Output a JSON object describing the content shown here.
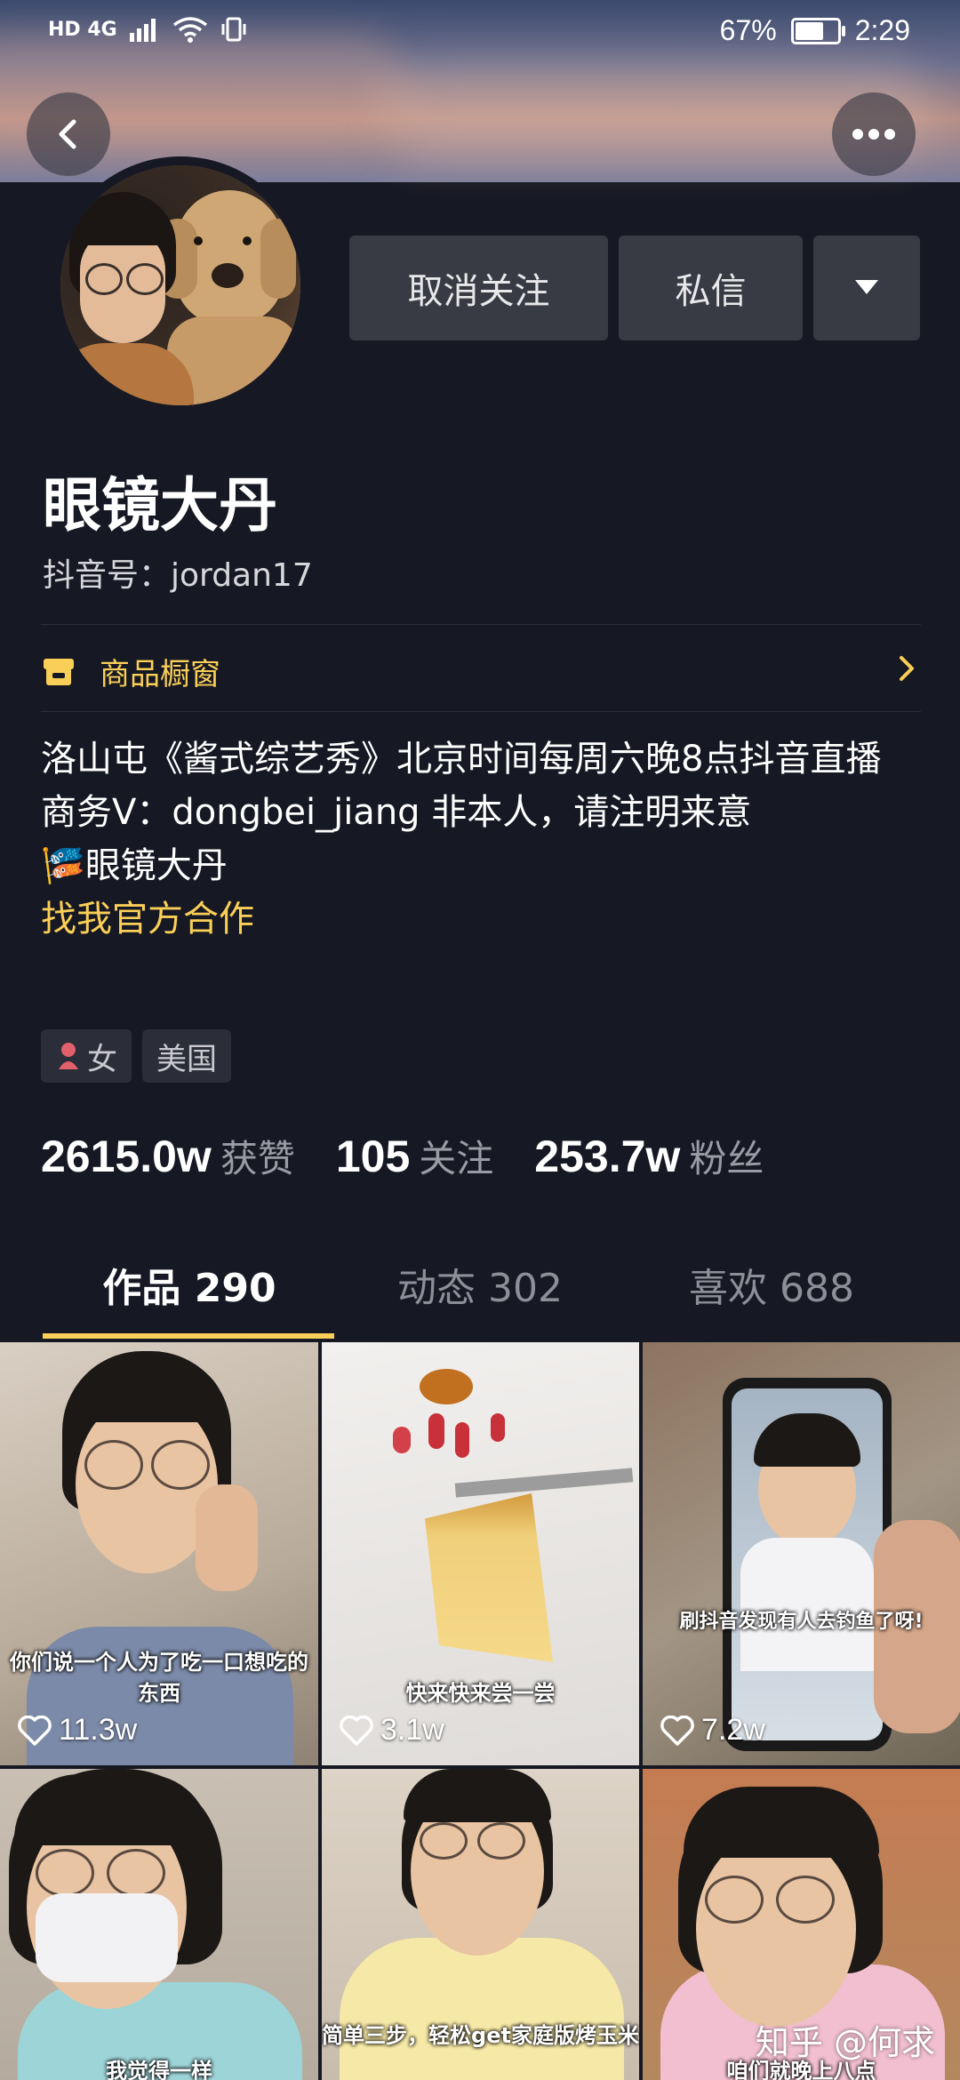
{
  "status_bar": {
    "network": "HD 4G",
    "battery": "67%",
    "battery_level": 0.67,
    "time": "2:29"
  },
  "header": {
    "back_icon": "chevron-left-icon",
    "more_icon": "more-dots-icon"
  },
  "profile": {
    "name": "眼镜大丹",
    "douyin_id": "抖音号：jordan17",
    "actions": {
      "unfollow": "取消关注",
      "message": "私信",
      "dropdown_icon": "triangle-down-icon"
    },
    "shop": {
      "label": "商品橱窗",
      "icon": "shop-icon"
    },
    "bio": {
      "line1": "洛山屯《酱式综艺秀》北京时间每周六晚8点抖音直播",
      "line2": "商务V：dongbei_jiang 非本人，请注明来意",
      "line3_emoji": "🎏",
      "line3": "眼镜大丹",
      "link": "找我官方合作"
    },
    "tags": {
      "gender_icon": "female-icon",
      "gender": "女",
      "location": "美国"
    },
    "stats": {
      "likes_value": "2615.0w",
      "likes_label": "获赞",
      "following_value": "105",
      "following_label": "关注",
      "followers_value": "253.7w",
      "followers_label": "粉丝"
    }
  },
  "tabs": [
    {
      "label": "作品 290",
      "active": true
    },
    {
      "label": "动态 302",
      "active": false
    },
    {
      "label": "喜欢 688",
      "active": false
    }
  ],
  "videos": [
    {
      "caption": "你们说一个人为了吃一口想吃的东西",
      "likes": "11.3w"
    },
    {
      "caption": "快来快来尝一尝",
      "likes": "3.1w"
    },
    {
      "caption": "刷抖音发现有人去钓鱼了呀!",
      "likes": "7.2w"
    },
    {
      "caption": "我觉得一样",
      "likes": ""
    },
    {
      "caption": "简单三步，轻松get家庭版烤玉米",
      "likes": ""
    },
    {
      "caption": "咱们就晚上八点",
      "likes": ""
    }
  ],
  "watermark": "知乎 @何求",
  "colors": {
    "background": "#161823",
    "accent": "#facf57",
    "button": "#393b44"
  }
}
